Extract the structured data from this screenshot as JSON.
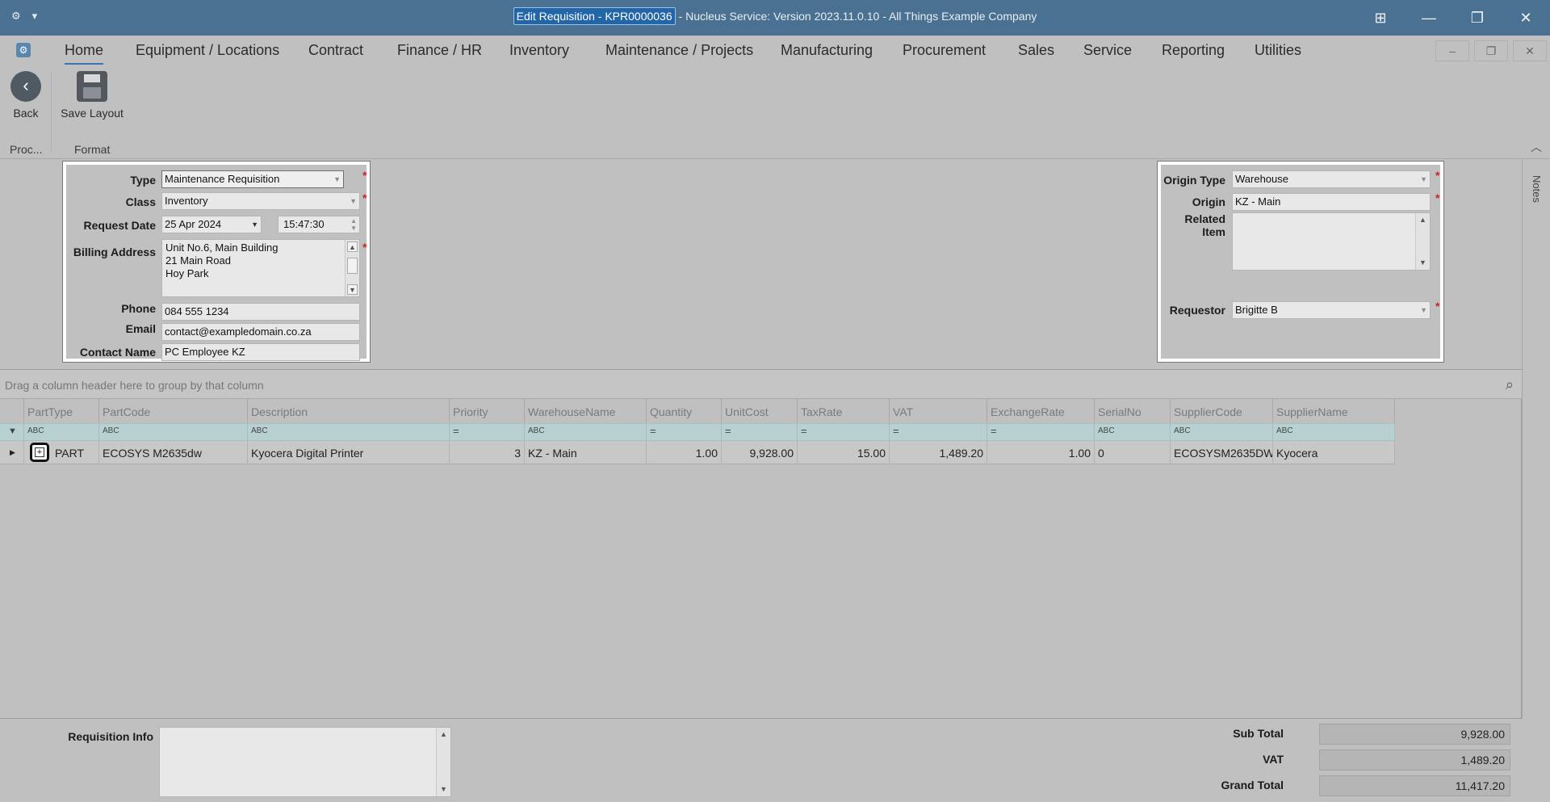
{
  "window": {
    "title_highlight": "Edit Requisition - KPR0000036",
    "title_rest": " - Nucleus Service: Version 2023.11.0.10 - All Things Example Company",
    "left_icons": [
      "gear-icon",
      "caret-down-icon"
    ],
    "controls": [
      "layout-icon",
      "minimize-icon",
      "restore-icon",
      "close-icon"
    ]
  },
  "menu": {
    "items": [
      "Home",
      "Equipment / Locations",
      "Contract",
      "Finance / HR",
      "Inventory",
      "Maintenance / Projects",
      "Manufacturing",
      "Procurement",
      "Sales",
      "Service",
      "Reporting",
      "Utilities"
    ],
    "active": "Home"
  },
  "ribbon": {
    "back_label": "Back",
    "save_layout_label": "Save Layout",
    "group_proc": "Proc...",
    "group_format": "Format"
  },
  "form": {
    "type_label": "Type",
    "type_value": "Maintenance Requisition",
    "class_label": "Class",
    "class_value": "Inventory",
    "request_date_label": "Request Date",
    "request_date_value": "25 Apr 2024",
    "request_time_value": "15:47:30",
    "billing_label": "Billing Address",
    "billing_lines": [
      "Unit No.6, Main Building",
      "21 Main Road",
      "Hoy Park"
    ],
    "phone_label": "Phone",
    "phone_value": "084 555 1234",
    "email_label": "Email",
    "email_value": "contact@exampledomain.co.za",
    "contact_label": "Contact Name",
    "contact_value": "PC Employee KZ",
    "origin_type_label": "Origin Type",
    "origin_type_value": "Warehouse",
    "origin_label": "Origin",
    "origin_value": "KZ - Main",
    "related_item_label_1": "Related",
    "related_item_label_2": "Item",
    "requestor_label": "Requestor",
    "requestor_value": "Brigitte B",
    "required_mark": "*"
  },
  "grid": {
    "group_hint": "Drag a column header here to group by that column",
    "columns": [
      "PartType",
      "PartCode",
      "Description",
      "Priority",
      "WarehouseName",
      "Quantity",
      "UnitCost",
      "TaxRate",
      "VAT",
      "ExchangeRate",
      "SerialNo",
      "SupplierCode",
      "SupplierName"
    ],
    "filter_text": "ABC",
    "filter_eq": "=",
    "row": {
      "PartType": "PART",
      "PartCode": "ECOSYS M2635dw",
      "Description": "Kyocera Digital Printer",
      "Priority": "3",
      "WarehouseName": "KZ - Main",
      "Quantity": "1.00",
      "UnitCost": "9,928.00",
      "TaxRate": "15.00",
      "VAT": "1,489.20",
      "ExchangeRate": "1.00",
      "SerialNo": "0",
      "SupplierCode": "ECOSYSM2635DW",
      "SupplierName": "Kyocera"
    }
  },
  "footer": {
    "requisition_info_label": "Requisition Info",
    "sub_total_label": "Sub Total",
    "sub_total_value": "9,928.00",
    "vat_label": "VAT",
    "vat_value": "1,489.20",
    "grand_total_label": "Grand Total",
    "grand_total_value": "11,417.20"
  },
  "side": {
    "notes_label": "Notes"
  }
}
